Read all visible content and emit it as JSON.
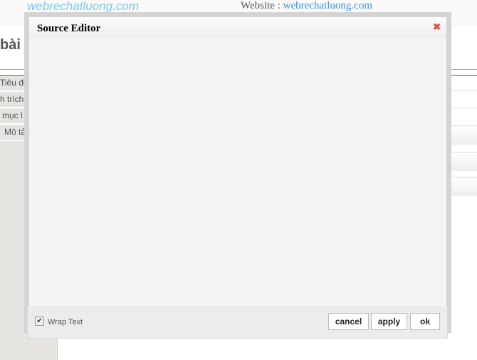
{
  "background": {
    "logo": "webrechatluong.com",
    "website_label": "Website : ",
    "website_link": "webrechatluong.com",
    "page_title": "bài v",
    "form_rows": [
      "Tiêu đề",
      "h trích",
      "mục l",
      "Mô tả"
    ]
  },
  "dialog": {
    "title": "Source Editor",
    "close_icon": "close-x-icon",
    "editor_content": "",
    "wrap_text_label": "Wrap Text",
    "wrap_text_checked": true,
    "buttons": {
      "cancel": "cancel",
      "apply": "apply",
      "ok": "ok"
    }
  },
  "colors": {
    "logo": "#7cc7f0",
    "close": "#e0524a"
  }
}
